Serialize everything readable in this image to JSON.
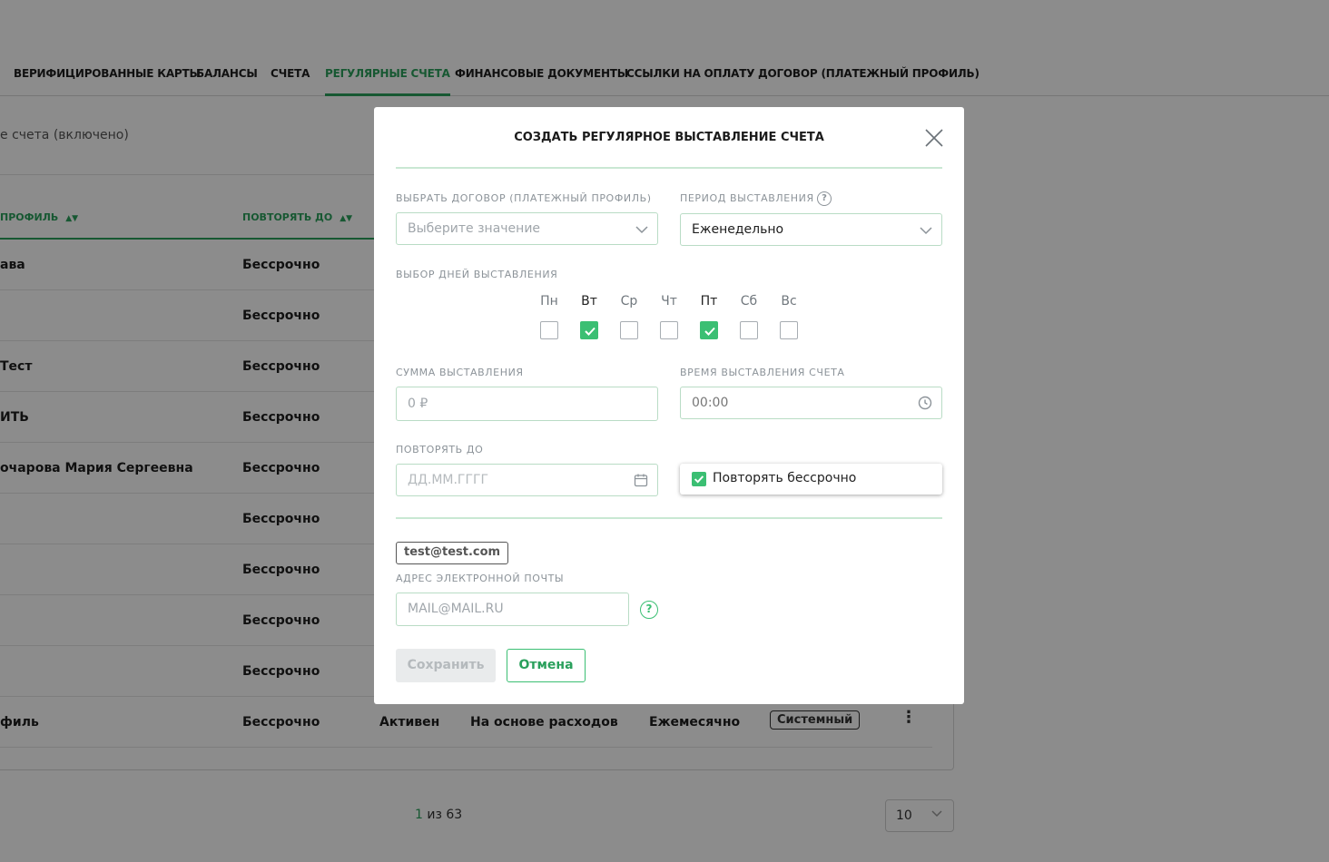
{
  "tabs": [
    {
      "label": "ВЕРИФИЦИРОВАННЫЕ КАРТЫ",
      "active": false
    },
    {
      "label": "БАЛАНСЫ",
      "active": false
    },
    {
      "label": "СЧЕТА",
      "active": false
    },
    {
      "label": "РЕГУЛЯРНЫЕ СЧЕТА",
      "active": true
    },
    {
      "label": "ФИНАНСОВЫЕ ДОКУМЕНТЫ",
      "active": false
    },
    {
      "label": "ССЫЛКИ НА ОПЛАТУ",
      "active": false
    },
    {
      "label": "ДОГОВОР (ПЛАТЕЖНЫЙ ПРОФИЛЬ)",
      "active": false
    }
  ],
  "filter_text": "е счета (включено)",
  "table": {
    "headers": [
      "ПРОФИЛЬ",
      "ПОВТОРЯТЬ ДО"
    ],
    "rows": [
      {
        "profile": "ава",
        "until": "Бессрочно"
      },
      {
        "profile": "",
        "until": "Бессрочно"
      },
      {
        "profile": "Тест",
        "until": "Бессрочно"
      },
      {
        "profile": "ИТЬ",
        "until": "Бессрочно"
      },
      {
        "profile": "очарова Мария Сергеевна",
        "until": "Бессрочно"
      },
      {
        "profile": "",
        "until": "Бессрочно"
      },
      {
        "profile": "",
        "until": "Бессрочно"
      },
      {
        "profile": "",
        "until": "Бессрочно"
      },
      {
        "profile": "",
        "until": "Бессрочно"
      },
      {
        "profile": "филь",
        "until": "Бессрочно",
        "status": "Активен",
        "type": "На основе расходов",
        "period": "Ежемесячно",
        "badge": "Системный"
      }
    ]
  },
  "pager": {
    "current": "1",
    "of_text": " из 63",
    "page_size": "10"
  },
  "modal": {
    "title": "СОЗДАТЬ РЕГУЛЯРНОЕ ВЫСТАВЛЕНИЕ СЧЕТА",
    "contract_label": "ВЫБРАТЬ ДОГОВОР (ПЛАТЕЖНЫЙ ПРОФИЛЬ)",
    "contract_placeholder": "Выберите значение",
    "period_label": "ПЕРИОД ВЫСТАВЛЕНИЯ",
    "period_value": "Еженедельно",
    "days_label": "ВЫБОР ДНЕЙ ВЫСТАВЛЕНИЯ",
    "days": [
      {
        "label": "Пн",
        "checked": false
      },
      {
        "label": "Вт",
        "checked": true
      },
      {
        "label": "Ср",
        "checked": false
      },
      {
        "label": "Чт",
        "checked": false
      },
      {
        "label": "Пт",
        "checked": true
      },
      {
        "label": "Сб",
        "checked": false
      },
      {
        "label": "Вс",
        "checked": false
      }
    ],
    "amount_label": "СУММА ВЫСТАВЛЕНИЯ",
    "amount_placeholder": "0 ₽",
    "time_label": "ВРЕМЯ ВЫСТАВЛЕНИЯ СЧЕТА",
    "time_value": "00:00",
    "until_label": "ПОВТОРЯТЬ ДО",
    "until_placeholder": "ДД.ММ.ГГГГ",
    "forever_label": "Повторять бессрочно",
    "email_chip": "test@test.com",
    "email_label": "АДРЕС ЭЛЕКТРОННОЙ ПОЧТЫ",
    "email_placeholder": "MAIL@MAIL.RU",
    "save_label": "Сохранить",
    "cancel_label": "Отмена"
  },
  "colors": {
    "accent": "#2aa05c",
    "checkbox": "#3bbf73",
    "overlay": "rgba(0,0,0,0.45)"
  }
}
